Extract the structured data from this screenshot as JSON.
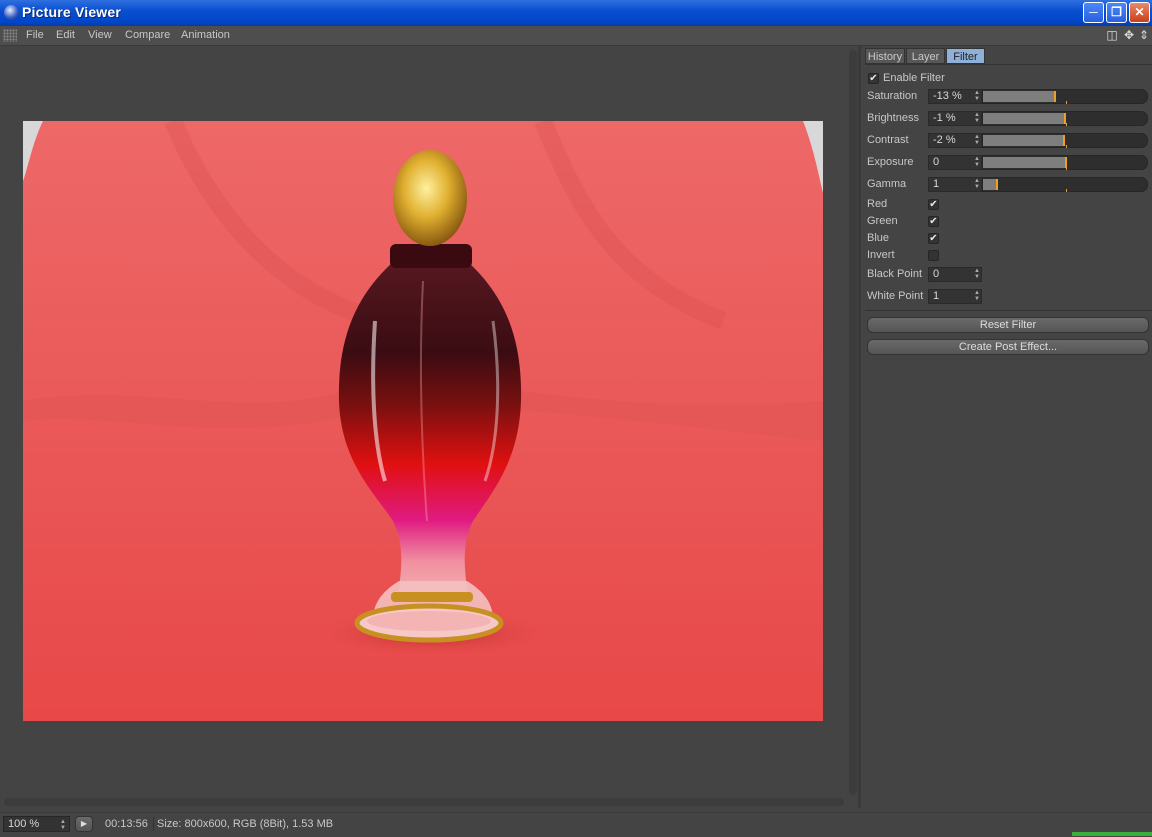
{
  "window": {
    "title": "Picture Viewer"
  },
  "menu": {
    "items": [
      "File",
      "Edit",
      "View",
      "Compare",
      "Animation"
    ]
  },
  "panel": {
    "tabs": [
      {
        "label": "History",
        "active": false
      },
      {
        "label": "Layer",
        "active": false
      },
      {
        "label": "Filter",
        "active": true
      }
    ],
    "enable_filter": {
      "label": "Enable Filter",
      "checked": true
    },
    "sliders": [
      {
        "label": "Saturation",
        "value": "-13 %",
        "level": 0.435
      },
      {
        "label": "Brightness",
        "value": "-1 %",
        "level": 0.495
      },
      {
        "label": "Contrast",
        "value": "-2 %",
        "level": 0.49
      },
      {
        "label": "Exposure",
        "value": "0",
        "level": 0.5
      },
      {
        "label": "Gamma",
        "value": "1",
        "level": 0.08
      }
    ],
    "checkboxes": [
      {
        "label": "Red",
        "checked": true
      },
      {
        "label": "Green",
        "checked": true
      },
      {
        "label": "Blue",
        "checked": true
      },
      {
        "label": "Invert",
        "checked": false
      }
    ],
    "points": [
      {
        "label": "Black Point",
        "value": "0"
      },
      {
        "label": "White Point",
        "value": "1"
      }
    ],
    "reset_button": "Reset Filter",
    "post_effect_button": "Create Post Effect..."
  },
  "status": {
    "zoom": "100 %",
    "time": "00:13:56",
    "info": "Size: 800x600, RGB (8Bit), 1.53 MB"
  },
  "icons": {
    "app": "c4d-sphere-icon",
    "minimize": "minimize-icon",
    "restore": "restore-icon",
    "close": "close-icon",
    "layout": "panel-layout-icon",
    "move": "move-arrows-icon",
    "scroll": "scroll-arrows-icon",
    "play": "play-icon"
  }
}
